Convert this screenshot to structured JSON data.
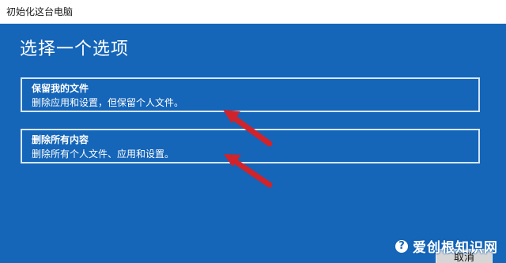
{
  "window": {
    "title": "初始化这台电脑"
  },
  "dialog": {
    "heading": "选择一个选项",
    "options": [
      {
        "title": "保留我的文件",
        "description": "删除应用和设置，但保留个人文件。"
      },
      {
        "title": "删除所有内容",
        "description": "删除所有个人文件、应用和设置。"
      }
    ],
    "cancel_label": "取消"
  },
  "watermark": {
    "logo": "?",
    "text": "爱创根知识网"
  },
  "colors": {
    "dialog_background": "#1565b8",
    "arrow": "#d2232a"
  },
  "annotations": {
    "arrows": [
      "red-arrow-pointing-to-option-1",
      "red-arrow-pointing-to-option-2"
    ]
  }
}
